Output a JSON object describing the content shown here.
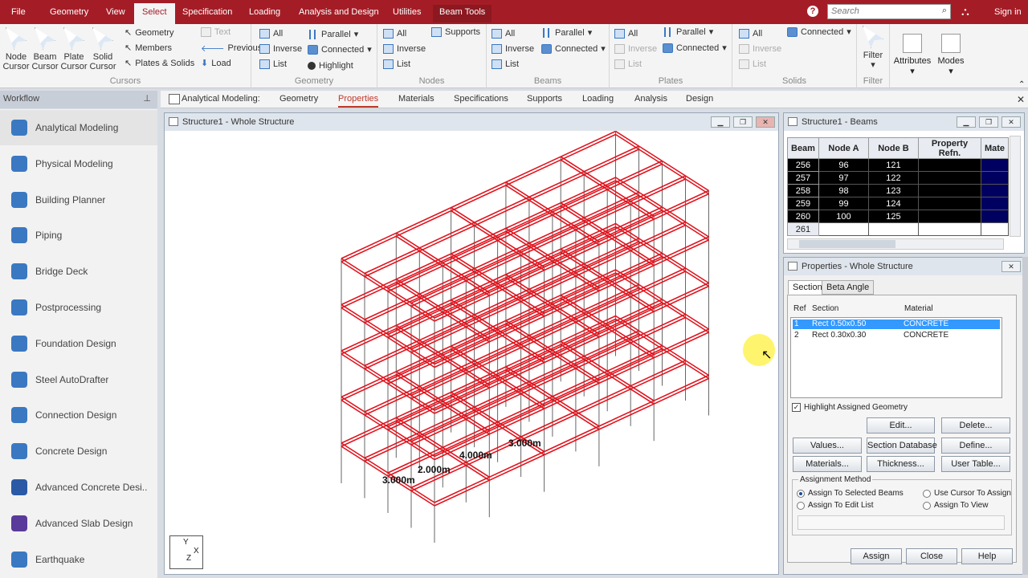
{
  "menubar": {
    "items": [
      "File",
      "Geometry",
      "View",
      "Select",
      "Specification",
      "Loading",
      "Analysis and Design",
      "Utilities"
    ],
    "context_tab": "Beam Tools",
    "search_placeholder": "Search",
    "sign_in": "Sign in",
    "help": "?"
  },
  "ribbon": {
    "cursors": {
      "label": "Cursors",
      "buttons": [
        "Node Cursor",
        "Beam Cursor",
        "Plate Cursor",
        "Solid Cursor"
      ],
      "items": [
        "Geometry",
        "Members",
        "Plates & Solids",
        "Text",
        "Previous",
        "Load"
      ]
    },
    "geometry": {
      "label": "Geometry",
      "items": [
        "All",
        "Inverse",
        "List",
        "Parallel",
        "Connected",
        "Highlight"
      ]
    },
    "nodes": {
      "label": "Nodes",
      "items": [
        "All",
        "Inverse",
        "List",
        "Supports"
      ]
    },
    "beams": {
      "label": "Beams",
      "items": [
        "All",
        "Inverse",
        "List",
        "Parallel",
        "Connected"
      ]
    },
    "plates": {
      "label": "Plates",
      "items": [
        "All",
        "Inverse",
        "List",
        "Parallel",
        "Connected"
      ]
    },
    "solids": {
      "label": "Solids",
      "items": [
        "All",
        "Inverse",
        "List",
        "Connected"
      ]
    },
    "filter": {
      "label": "Filter",
      "button": "Filter"
    },
    "attributes": "Attributes",
    "modes": "Modes"
  },
  "workflow": {
    "title": "Workflow",
    "items": [
      "Analytical Modeling",
      "Physical Modeling",
      "Building Planner",
      "Piping",
      "Bridge Deck",
      "Postprocessing",
      "Foundation Design",
      "Steel AutoDrafter",
      "Connection Design",
      "Concrete Design",
      "Advanced Concrete Desi...",
      "Advanced Slab Design",
      "Earthquake"
    ]
  },
  "tabs": {
    "prefix": "Analytical Modeling:",
    "items": [
      "Geometry",
      "Properties",
      "Materials",
      "Specifications",
      "Supports",
      "Loading",
      "Analysis",
      "Design"
    ],
    "active": "Properties"
  },
  "structure_window": {
    "title": "Structure1 - Whole Structure",
    "dims": [
      "3.000m",
      "4.000m",
      "2.000m",
      "3.000m"
    ],
    "axis": {
      "y": "Y",
      "x": "X",
      "z": "Z"
    },
    "frame_color": "#e0141e"
  },
  "beams_window": {
    "title": "Structure1 - Beams",
    "columns": [
      "Beam",
      "Node A",
      "Node B",
      "Property Refn.",
      "Mate"
    ],
    "rows": [
      {
        "beam": "256",
        "a": "96",
        "b": "121"
      },
      {
        "beam": "257",
        "a": "97",
        "b": "122"
      },
      {
        "beam": "258",
        "a": "98",
        "b": "123"
      },
      {
        "beam": "259",
        "a": "99",
        "b": "124"
      },
      {
        "beam": "260",
        "a": "100",
        "b": "125"
      },
      {
        "beam": "261",
        "a": "",
        "b": ""
      }
    ]
  },
  "properties_window": {
    "title": "Properties - Whole Structure",
    "tabs": [
      "Section",
      "Beta Angle"
    ],
    "headers": [
      "Ref",
      "Section",
      "Material"
    ],
    "rows": [
      {
        "ref": "1",
        "section": "Rect 0.50x0.50",
        "material": "CONCRETE"
      },
      {
        "ref": "2",
        "section": "Rect 0.30x0.30",
        "material": "CONCRETE"
      }
    ],
    "highlight_checkbox": "Highlight Assigned Geometry",
    "buttons": {
      "edit": "Edit...",
      "delete": "Delete...",
      "values": "Values...",
      "section_db": "Section Database",
      "define": "Define...",
      "materials": "Materials...",
      "thickness": "Thickness...",
      "user_table": "User Table..."
    },
    "assignment": {
      "label": "Assignment Method",
      "options": [
        "Assign To Selected Beams",
        "Use Cursor To Assign",
        "Assign To Edit List",
        "Assign To View"
      ]
    },
    "bottom_buttons": [
      "Assign",
      "Close",
      "Help"
    ]
  },
  "colors": {
    "brand": "#a41d26",
    "selection": "#3399ff",
    "frame": "#e0141e"
  }
}
